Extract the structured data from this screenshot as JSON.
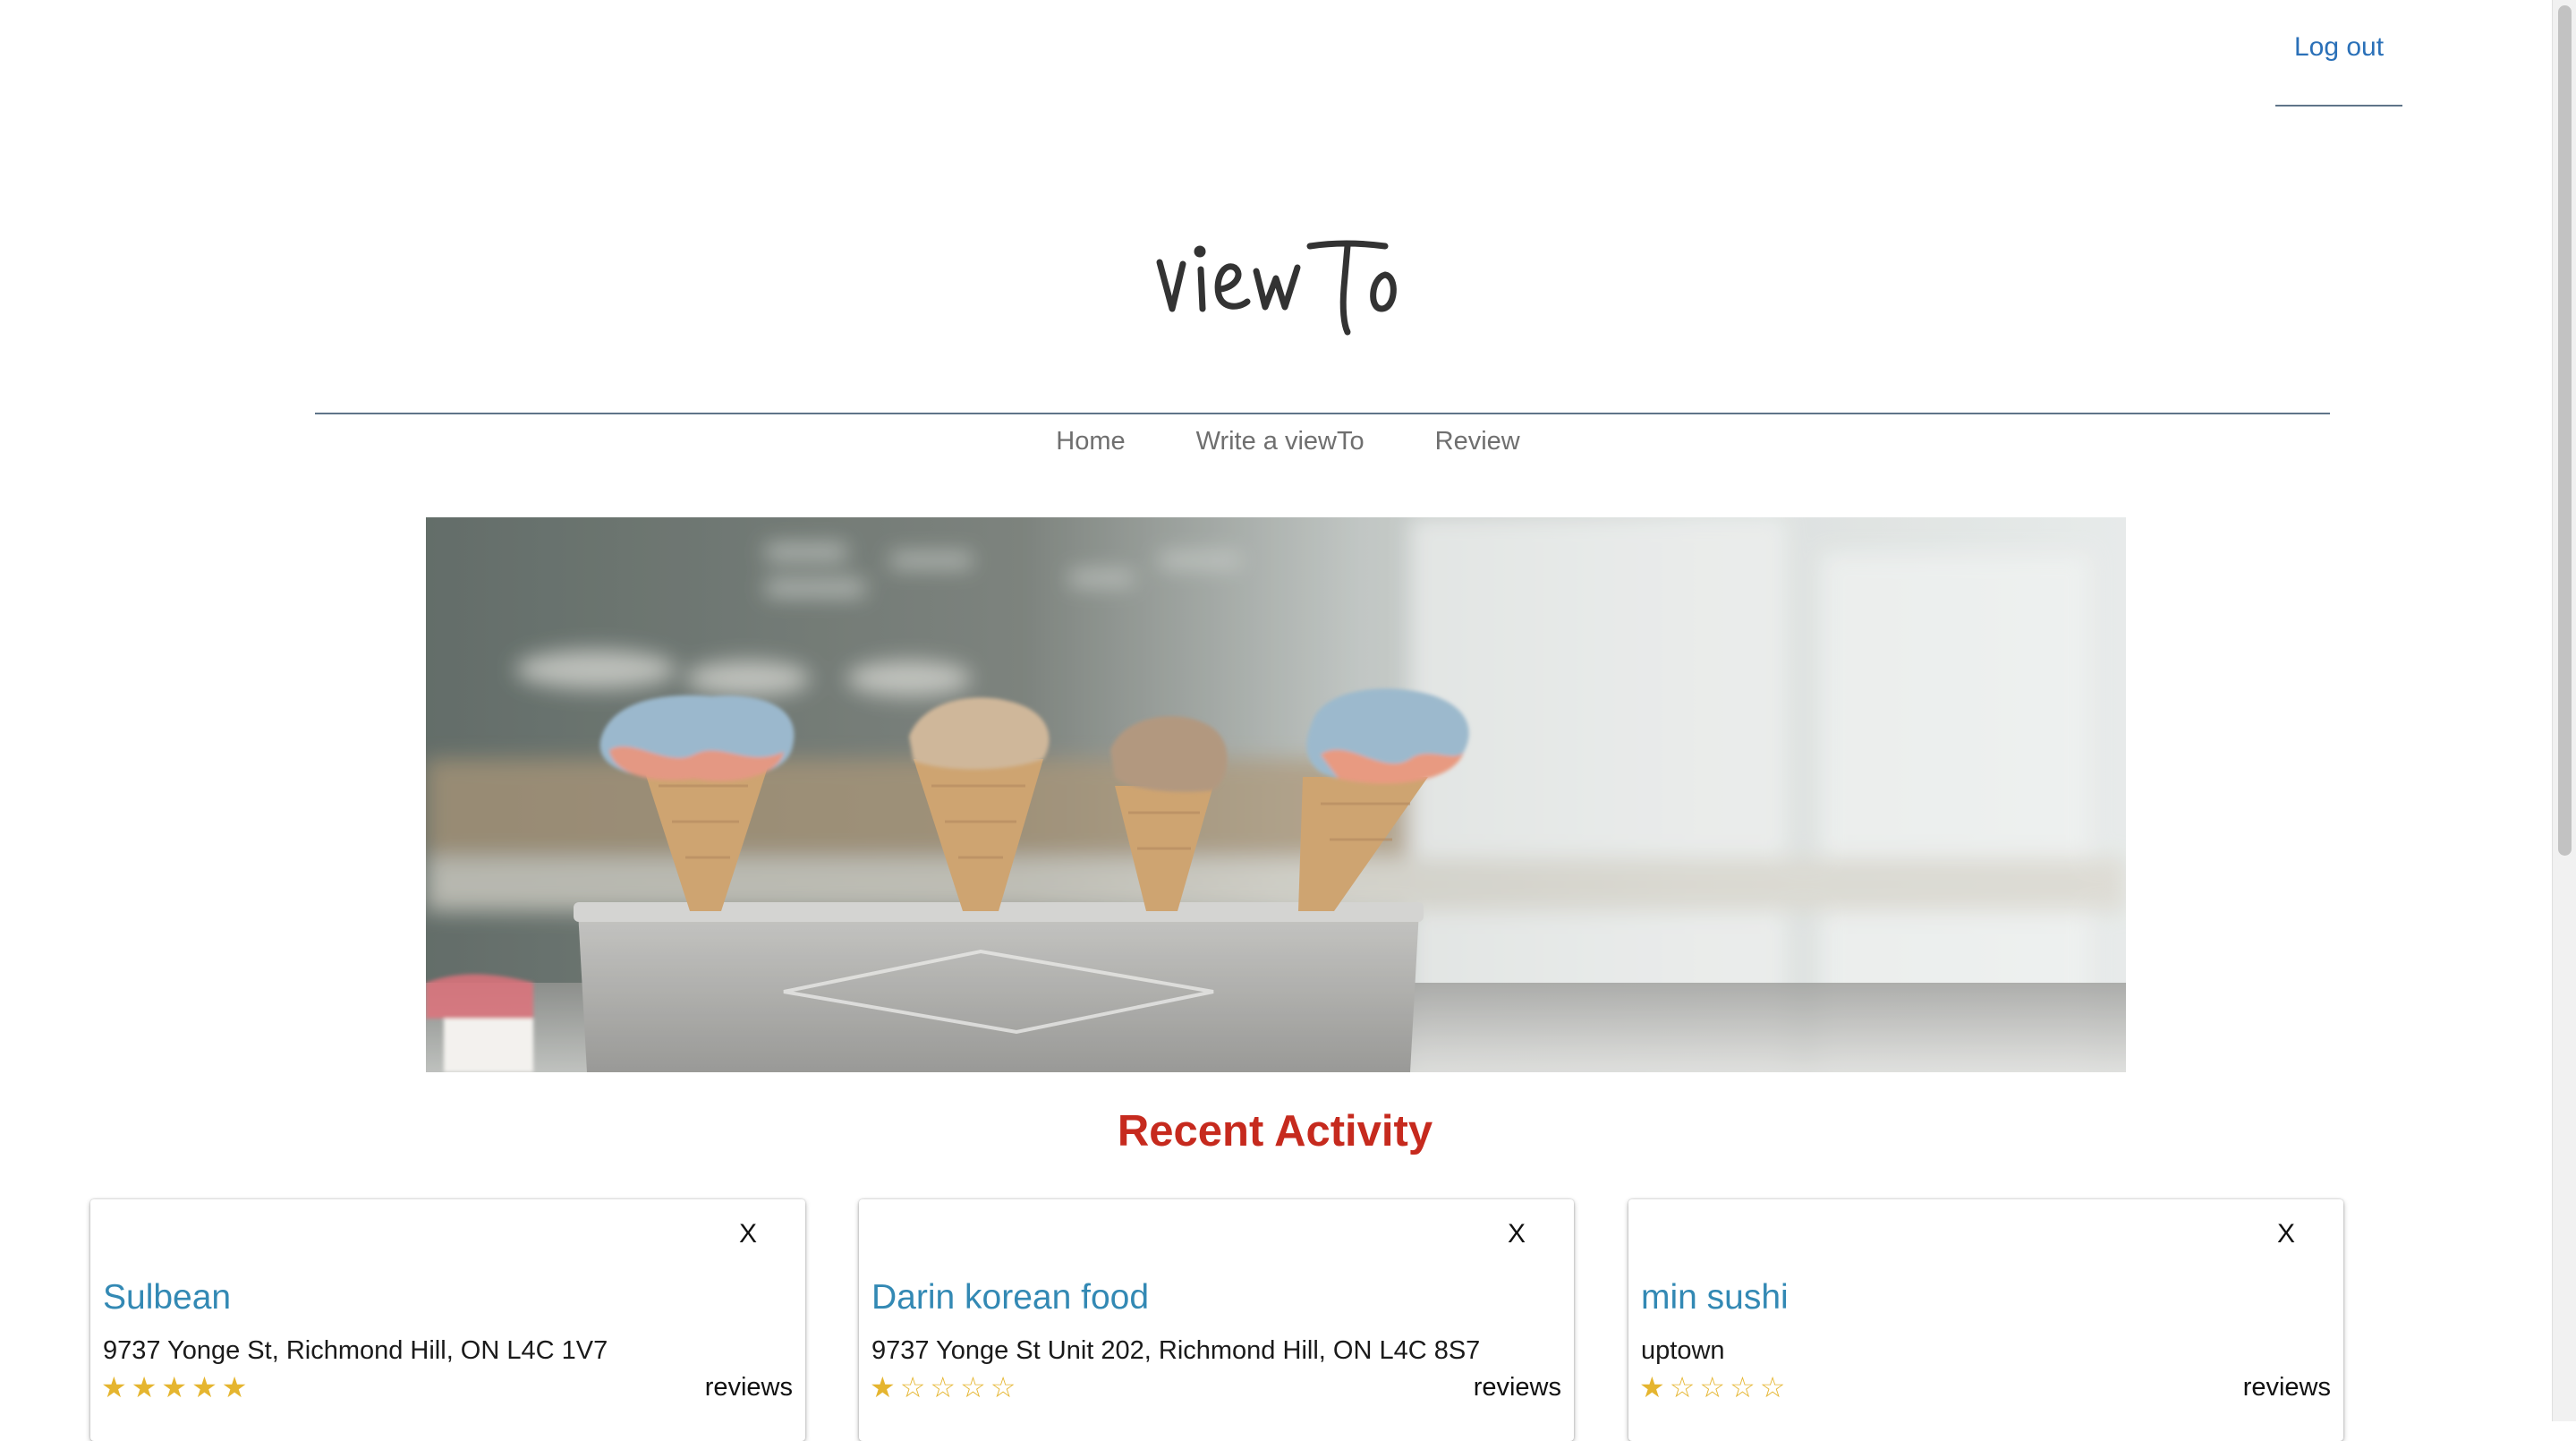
{
  "header": {
    "logout_label": "Log out",
    "logo_text": "viewTo"
  },
  "nav": {
    "items": [
      "Home",
      "Write a viewTo",
      "Review"
    ]
  },
  "section": {
    "title": "Recent Activity"
  },
  "cards": [
    {
      "close_label": "X",
      "name": "Sulbean",
      "address": "9737 Yonge St, Richmond Hill, ON L4C 1V7",
      "rating": 5,
      "stars": "★★★★★",
      "reviews_label": "reviews"
    },
    {
      "close_label": "X",
      "name": "Darin korean food",
      "address": "9737 Yonge St Unit 202, Richmond Hill, ON L4C 8S7",
      "rating": 1,
      "stars": "★☆☆☆☆",
      "reviews_label": "reviews"
    },
    {
      "close_label": "X",
      "name": "min sushi",
      "address": "uptown",
      "rating": 1,
      "stars": "★☆☆☆☆",
      "reviews_label": "reviews"
    }
  ],
  "colors": {
    "accent": "#2a70b8",
    "heading": "#c62a1e",
    "card_title": "#3389b4",
    "star": "#e5b52f"
  }
}
